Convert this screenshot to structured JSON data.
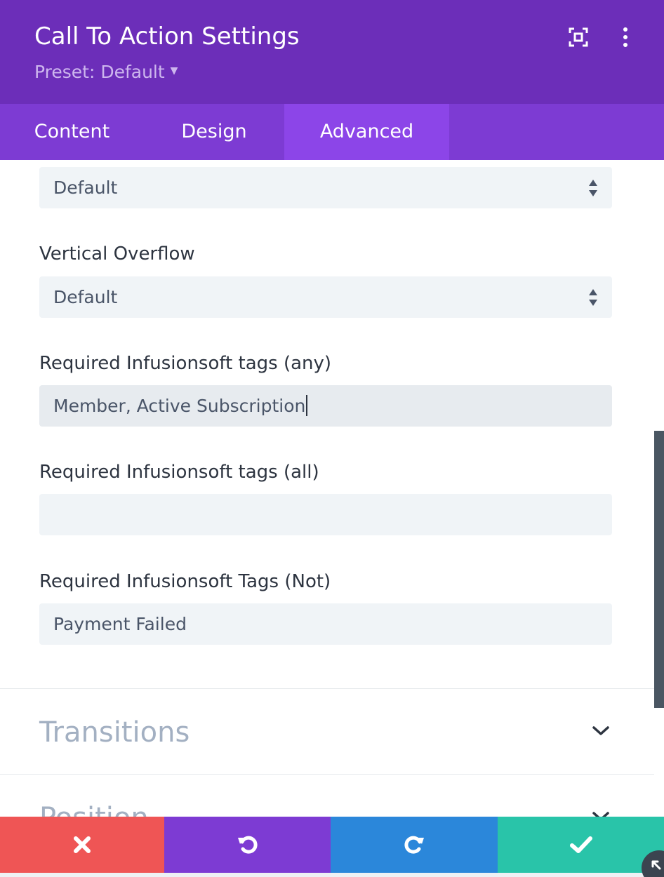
{
  "header": {
    "title": "Call To Action Settings",
    "preset_label": "Preset: Default",
    "icons": [
      "fullscreen-icon",
      "more-vertical-icon"
    ]
  },
  "tabs": [
    {
      "label": "Content",
      "active": false
    },
    {
      "label": "Design",
      "active": false
    },
    {
      "label": "Advanced",
      "active": true
    }
  ],
  "fields": {
    "overflow_top": {
      "value": "Default"
    },
    "vertical_overflow": {
      "label": "Vertical Overflow",
      "value": "Default"
    },
    "tags_any": {
      "label": "Required Infusionsoft tags (any)",
      "value": "Member, Active Subscription"
    },
    "tags_all": {
      "label": "Required Infusionsoft tags (all)",
      "value": ""
    },
    "tags_not": {
      "label": "Required Infusionsoft Tags (Not)",
      "value": "Payment Failed"
    }
  },
  "sections": [
    {
      "title": "Transitions"
    },
    {
      "title": "Position"
    }
  ],
  "footer": {
    "buttons": [
      "close-icon",
      "undo-icon",
      "redo-icon",
      "check-icon"
    ]
  },
  "colors": {
    "header_bg": "#6c2eb9",
    "tabs_bg": "#7d3bd3",
    "active_tab_bg": "#8c45e8",
    "close": "#ef5555",
    "undo": "#7d3bd3",
    "redo": "#2b87da",
    "save": "#29c4a9"
  }
}
